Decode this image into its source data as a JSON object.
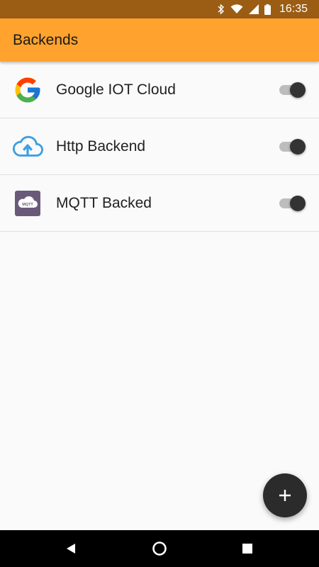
{
  "status_bar": {
    "time": "16:35",
    "icons": [
      "bluetooth-icon",
      "wifi-icon",
      "cell-signal-icon",
      "battery-icon"
    ],
    "background": "#9a5d13"
  },
  "app_bar": {
    "title": "Backends",
    "background": "#ffa22e"
  },
  "backends": [
    {
      "label": "Google IOT Cloud",
      "icon": "google-logo-icon",
      "enabled": true
    },
    {
      "label": "Http Backend",
      "icon": "cloud-upload-icon",
      "enabled": true
    },
    {
      "label": "MQTT Backed",
      "icon": "mqtt-logo-icon",
      "enabled": true
    }
  ],
  "mqtt_logo_text": "MQTT",
  "fab": {
    "icon": "add-icon",
    "background": "#2b2b2b"
  },
  "nav_bar": {
    "buttons": [
      "back-icon",
      "home-icon",
      "recents-icon"
    ]
  }
}
